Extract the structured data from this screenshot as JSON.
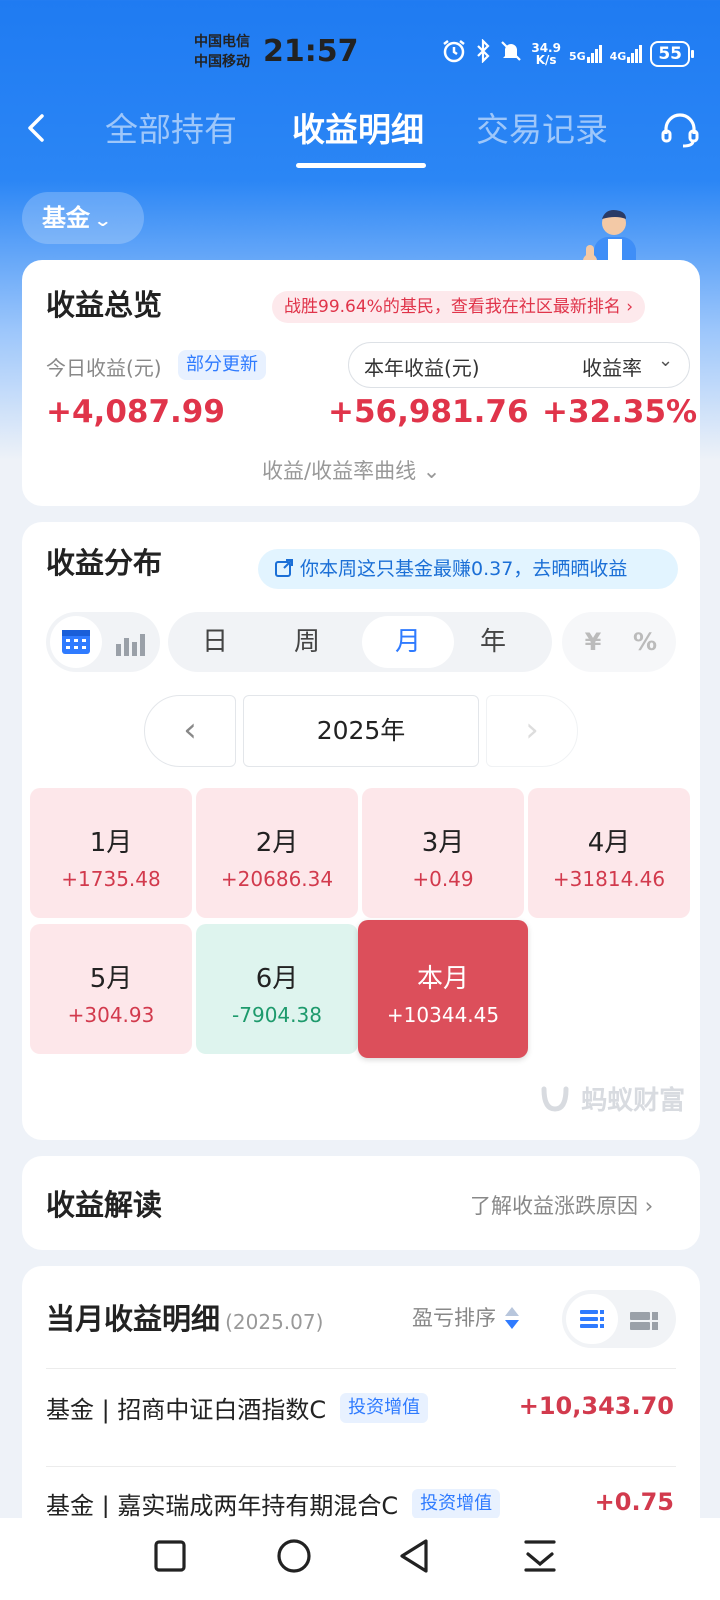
{
  "status_bar": {
    "carrier1": "中国电信",
    "carrier2": "中国移动",
    "time": "21:57",
    "net_speed_top": "34.9",
    "net_speed_bottom": "K/s",
    "sig1": "5G",
    "sig2": "4G",
    "battery": "55"
  },
  "nav": {
    "tabs": [
      "全部持有",
      "收益明细",
      "交易记录"
    ],
    "active_tab": "收益明细"
  },
  "filter": {
    "label": "基金"
  },
  "overview": {
    "title": "收益总览",
    "rank_banner": "战胜99.64%的基民，查看我在社区最新排名",
    "today_label": "今日收益(元)",
    "partial_badge": "部分更新",
    "today_value": "+4,087.99",
    "year_label": "本年收益(元)",
    "year_value": "+56,981.76",
    "rate_label": "收益率",
    "rate_value": "+32.35%",
    "curve_toggle": "收益/收益率曲线"
  },
  "distribution": {
    "title": "收益分布",
    "tip": "你本周这只基金最赚0.37，去晒晒收益",
    "periods": [
      "日",
      "周",
      "月",
      "年"
    ],
    "active_period": "月",
    "units": [
      "¥",
      "%"
    ],
    "year": "2025年",
    "months": [
      {
        "label": "1月",
        "value": "+1735.48",
        "kind": "pos"
      },
      {
        "label": "2月",
        "value": "+20686.34",
        "kind": "pos"
      },
      {
        "label": "3月",
        "value": "+0.49",
        "kind": "pos"
      },
      {
        "label": "4月",
        "value": "+31814.46",
        "kind": "pos"
      },
      {
        "label": "5月",
        "value": "+304.93",
        "kind": "pos"
      },
      {
        "label": "6月",
        "value": "-7904.38",
        "kind": "neg"
      },
      {
        "label": "本月",
        "value": "+10344.45",
        "kind": "cur"
      }
    ],
    "watermark": "蚂蚁财富"
  },
  "explain": {
    "title": "收益解读",
    "link": "了解收益涨跌原因"
  },
  "monthly_detail": {
    "title": "当月收益明细",
    "date": "(2025.07)",
    "sort_label": "盈亏排序",
    "rows": [
      {
        "name": "基金 | 招商中证白酒指数C",
        "tag": "投资增值",
        "value": "+10,343.70"
      },
      {
        "name": "基金 | 嘉实瑞成两年持有期混合C",
        "tag": "投资增值",
        "value": "+0.75"
      }
    ]
  },
  "colors": {
    "brand_blue": "#1f7bf2",
    "gain_red": "#e0344a",
    "loss_green": "#1d9a6c",
    "current_month": "#dc4f5b"
  }
}
